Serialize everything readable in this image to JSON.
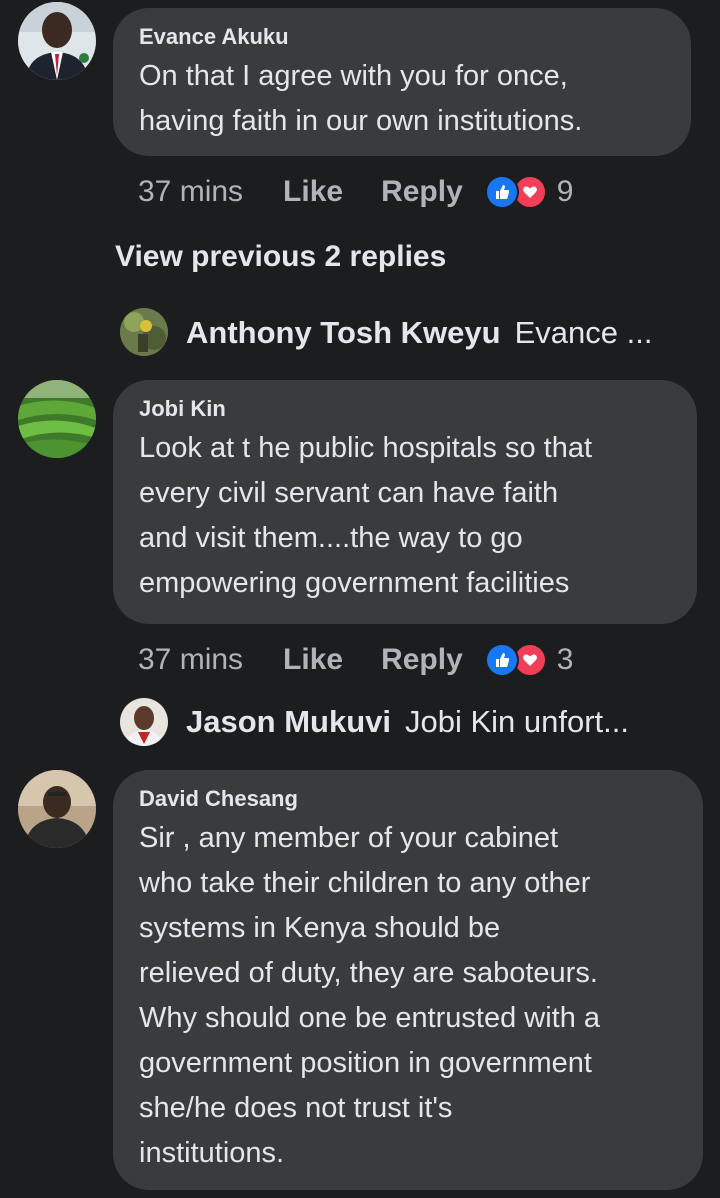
{
  "comments": [
    {
      "author": "Evance Akuku",
      "text_lines": [
        "On that I agree with you for once,",
        "having faith in our own institutions."
      ],
      "time": "37 mins",
      "like_label": "Like",
      "reply_label": "Reply",
      "reaction_count": "9"
    },
    {
      "author": "Jobi Kin",
      "text_lines": [
        "Look at t he public hospitals so that",
        "every civil servant can have faith",
        "and visit them....the way to go",
        "empowering government facilities"
      ],
      "time": "37 mins",
      "like_label": "Like",
      "reply_label": "Reply",
      "reaction_count": "3"
    },
    {
      "author": "David Chesang",
      "text_lines": [
        "Sir , any member of your cabinet",
        "who take their children to any other",
        "systems in Kenya should be",
        "relieved of duty, they are saboteurs.",
        "Why should one be entrusted with a",
        "government position in government",
        "she/he does not trust it's",
        "institutions."
      ]
    }
  ],
  "view_previous_label": "View previous 2 replies",
  "replies": [
    {
      "author": "Anthony Tosh Kweyu",
      "preview": "Evance ..."
    },
    {
      "author": "Jason Mukuvi",
      "preview": "Jobi Kin unfort..."
    }
  ],
  "colors": {
    "background": "#1c1d1f",
    "bubble": "#3a3b3c",
    "text": "#e4e6eb",
    "meta": "#b0b3b8",
    "like_blue": "#1877f2",
    "love_red": "#f33e58"
  },
  "icons": {
    "reaction_like": "thumbs-up-icon",
    "reaction_love": "heart-icon"
  }
}
